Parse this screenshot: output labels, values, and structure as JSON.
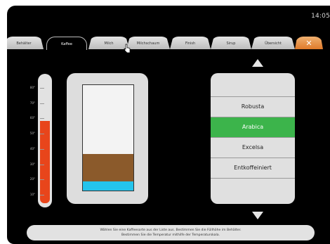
{
  "status_bar": {
    "time": "14:05"
  },
  "tabs": [
    {
      "label": "Behälter",
      "active": false
    },
    {
      "label": "Kaffee",
      "active": true
    },
    {
      "label": "Milch",
      "active": false
    },
    {
      "label": "Milchschaum",
      "active": false
    },
    {
      "label": "Finish",
      "active": false
    },
    {
      "label": "Sirup",
      "active": false
    },
    {
      "label": "Übersicht",
      "active": false
    },
    {
      "label": "✕",
      "active": false
    }
  ],
  "thermometer": {
    "ticks": [
      "80°",
      "70°",
      "60°",
      "50°",
      "40°",
      "30°",
      "20°",
      "10°"
    ],
    "value_fraction": 0.66,
    "color": "#e8451b"
  },
  "container": {
    "coffee_fraction": 0.26,
    "water_fraction": 0.09,
    "coffee_color": "#8b5a2b",
    "water_color": "#24c4ec"
  },
  "coffee_list": {
    "items": [
      "Robusta",
      "Arabica",
      "Excelsa",
      "Entkoffeiniert"
    ],
    "selected_index": 1,
    "selected_color": "#3cb44b"
  },
  "instructions": {
    "line1": "Wählen Sie eine Kaffeesorte aus der Liste aus. Bestimmen Sie die Füllhöhe im Behälter.",
    "line2": "Bestimmen Sie die Temperatur mithilfe der Temperaturskala."
  }
}
